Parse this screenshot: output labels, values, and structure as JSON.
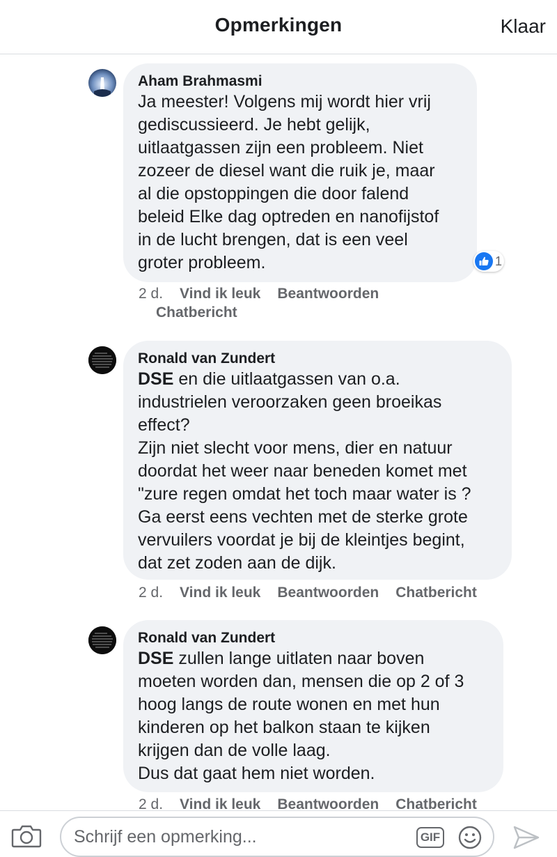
{
  "header": {
    "title": "Opmerkingen",
    "done_label": "Klaar"
  },
  "comments": [
    {
      "author": "Aham Brahmasmi",
      "mention": "",
      "text": "Ja meester! Volgens mij wordt hier vrij\ngediscussieerd. Je hebt gelijk,\nuitlaatgassen zijn een probleem. Niet\nzozeer de diesel want die ruik je, maar\nal die opstoppingen die door falend\nbeleid Elke dag optreden en nanofijstof\nin de lucht brengen, dat is een veel\ngroter probleem.",
      "time": "2 d.",
      "like_label": "Vind ik leuk",
      "reply_label": "Beantwoorden",
      "message_label": "Chatbericht",
      "reaction_count": "1",
      "reaction_icon": "thumbs-up-icon"
    },
    {
      "author": "Ronald van Zundert",
      "mention": "DSE",
      "text": " en die uitlaatgassen van o.a.\nindustrielen veroorzaken geen broeikas\neffect?\nZijn niet slecht voor mens, dier en natuur\ndoordat het weer naar beneden komet met\n\"zure regen omdat het toch maar water is ?\nGa eerst eens vechten met de sterke grote\nvervuilers voordat je bij de kleintjes begint,\ndat zet zoden aan de dijk.",
      "time": "2 d.",
      "like_label": "Vind ik leuk",
      "reply_label": "Beantwoorden",
      "message_label": "Chatbericht"
    },
    {
      "author": "Ronald van Zundert",
      "mention": "DSE",
      "text": " zullen lange uitlaten naar boven\nmoeten worden dan, mensen die op 2 of 3\nhoog langs de route wonen en met hun\nkinderen op het balkon staan te kijken\nkrijgen dan de volle laag.\nDus dat gaat hem niet worden.",
      "time": "2 d.",
      "like_label": "Vind ik leuk",
      "reply_label": "Beantwoorden",
      "message_label": "Chatbericht"
    }
  ],
  "composer": {
    "placeholder": "Schrijf een opmerking...",
    "gif_label": "GIF",
    "camera_icon": "camera-icon",
    "emoji_icon": "smiley-icon",
    "send_icon": "send-icon"
  },
  "colors": {
    "bubble": "#f0f2f5",
    "secondary_text": "#65676b",
    "like_blue": "#1877f2",
    "divider": "#dadde1"
  }
}
